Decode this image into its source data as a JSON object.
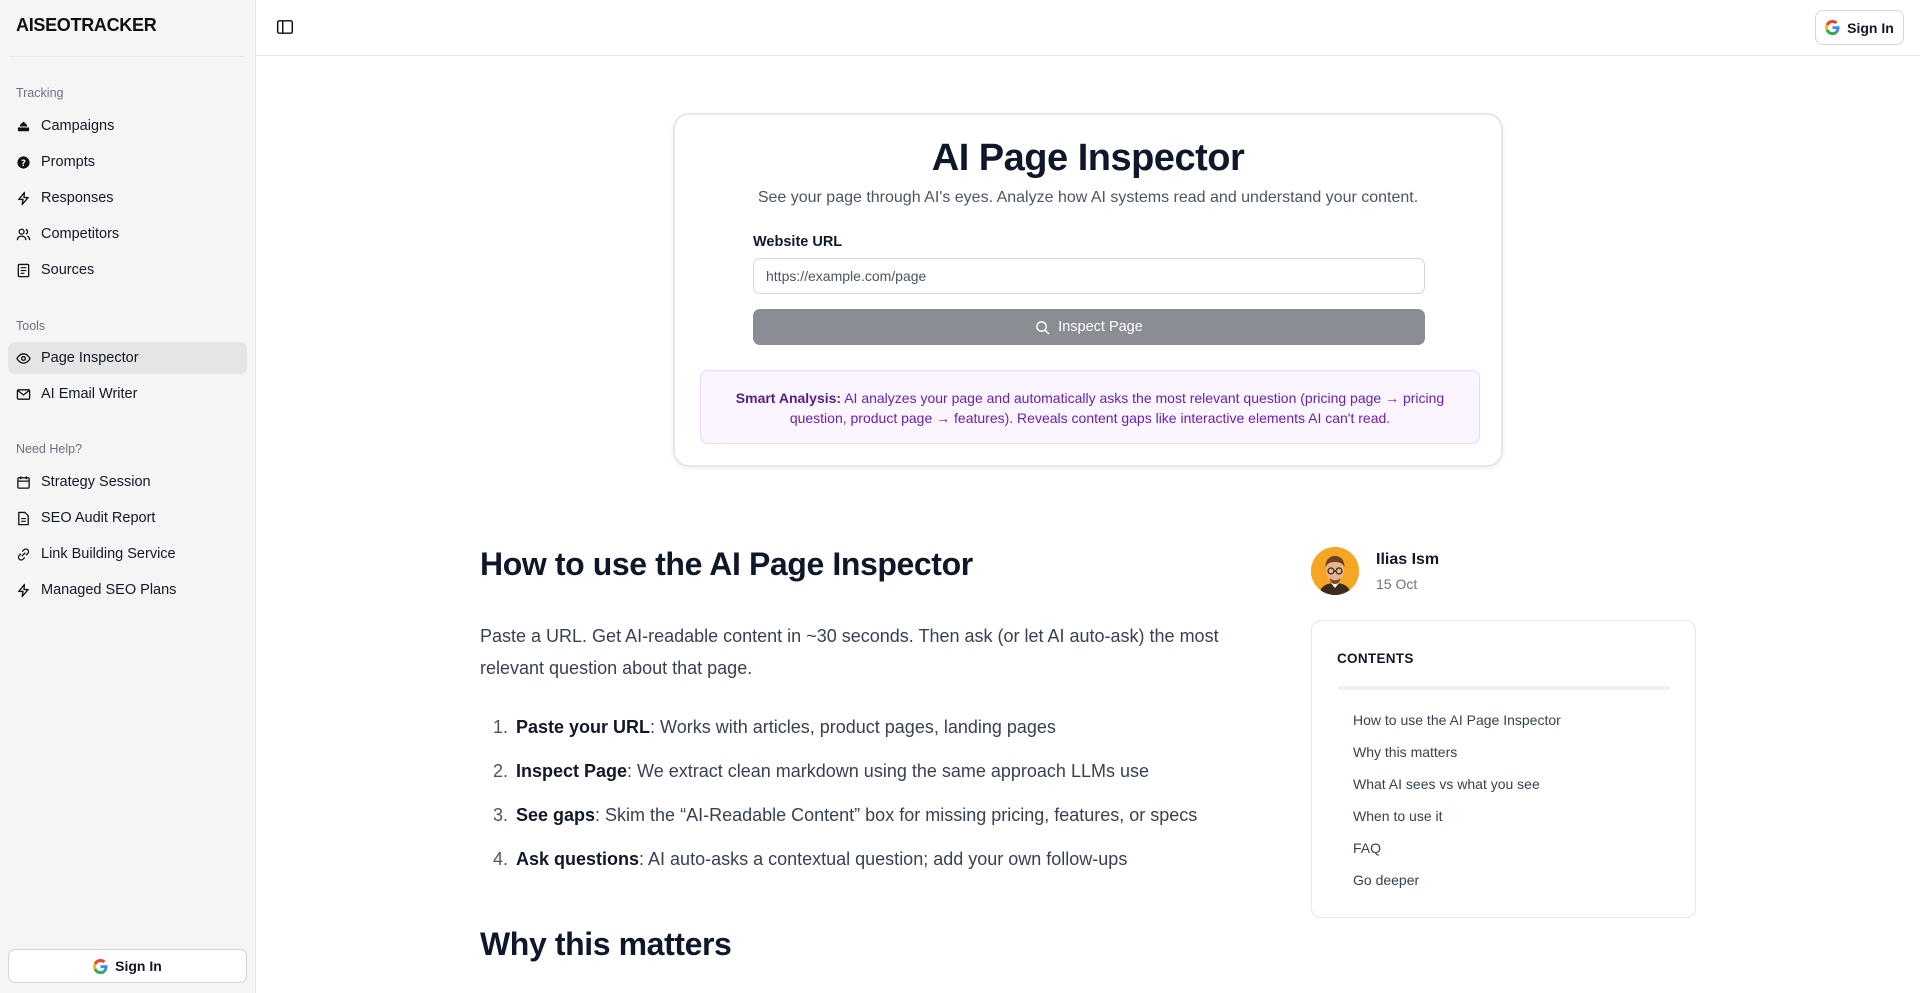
{
  "brand": "AISEOTRACKER",
  "sidebar": {
    "tracking_label": "Tracking",
    "tracking_items": [
      "Campaigns",
      "Prompts",
      "Responses",
      "Competitors",
      "Sources"
    ],
    "tools_label": "Tools",
    "tools_items": [
      "Page Inspector",
      "AI Email Writer"
    ],
    "help_label": "Need Help?",
    "help_items": [
      "Strategy Session",
      "SEO Audit Report",
      "Link Building Service",
      "Managed SEO Plans"
    ],
    "active_item": "Page Inspector",
    "sign_in": "Sign In"
  },
  "topbar": {
    "sign_in": "Sign In"
  },
  "inspector": {
    "title": "AI Page Inspector",
    "subtitle": "See your page through AI's eyes. Analyze how AI systems read and understand your content.",
    "url_label": "Website URL",
    "url_placeholder": "https://example.com/page",
    "button": "Inspect Page",
    "smart_label": "Smart Analysis:",
    "smart_text": " AI analyzes your page and automatically asks the most relevant question (pricing page → pricing question, product page → features). Reveals content gaps like interactive elements AI can't read."
  },
  "article": {
    "heading1": "How to use the AI Page Inspector",
    "intro": "Paste a URL. Get AI-readable content in ~30 seconds. Then ask (or let AI auto-ask) the most relevant question about that page.",
    "steps": [
      {
        "num": "1.",
        "title": "Paste your URL",
        "text": ": Works with articles, product pages, landing pages"
      },
      {
        "num": "2.",
        "title": "Inspect Page",
        "text": ": We extract clean markdown using the same approach LLMs use"
      },
      {
        "num": "3.",
        "title": "See gaps",
        "text": ": Skim the “AI-Readable Content” box for missing pricing, features, or specs"
      },
      {
        "num": "4.",
        "title": "Ask questions",
        "text": ": AI auto-asks a contextual question; add your own follow-ups"
      }
    ],
    "heading2": "Why this matters"
  },
  "author": {
    "name": "Ilias Ism",
    "date": "15 Oct"
  },
  "contents": {
    "title": "CONTENTS",
    "items": [
      "How to use the AI Page Inspector",
      "Why this matters",
      "What AI sees vs what you see",
      "When to use it",
      "FAQ",
      "Go deeper"
    ]
  },
  "colors": {
    "accent_purple": "#6b21a8",
    "button_gray": "#8a8d93",
    "sidebar_bg": "#f5f5f5"
  }
}
